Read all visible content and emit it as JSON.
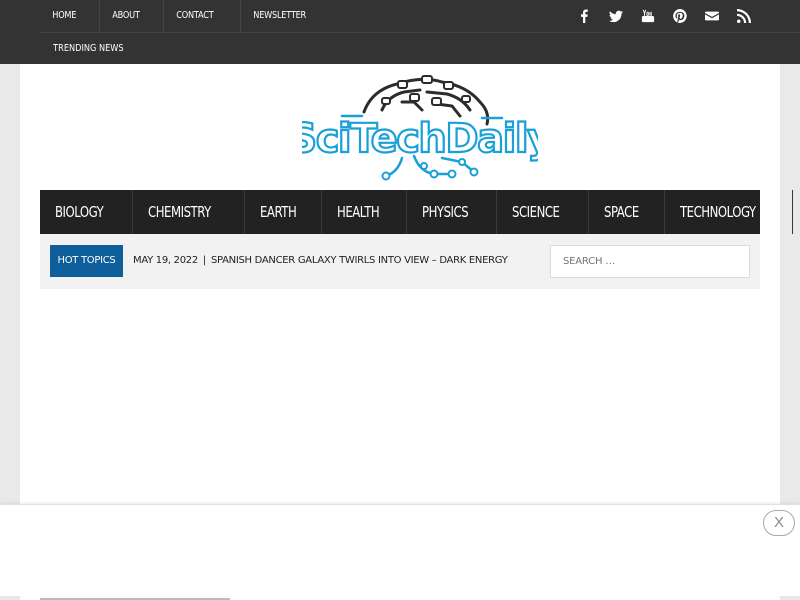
{
  "topnav": {
    "items": [
      "HOME",
      "ABOUT",
      "CONTACT",
      "NEWSLETTER"
    ],
    "trending": "TRENDING NEWS"
  },
  "social_icons": [
    "facebook-icon",
    "twitter-icon",
    "youtube-icon",
    "pinterest-icon",
    "envelope-icon",
    "rss-icon"
  ],
  "logo": {
    "text": "SciTechDaily"
  },
  "mainnav": {
    "items": [
      "BIOLOGY",
      "CHEMISTRY",
      "EARTH",
      "HEALTH",
      "PHYSICS",
      "SCIENCE",
      "SPACE",
      "TECHNOLOGY"
    ]
  },
  "ticker": {
    "label": "HOT TOPICS",
    "date": "MAY 19, 2022",
    "separator": "|",
    "headline": "SPANISH DANCER GALAXY TWIRLS INTO VIEW – DARK ENERGY"
  },
  "search": {
    "placeholder": "SEARCH …"
  },
  "ad": {
    "close_label": "X"
  },
  "colors": {
    "topbar": "#333333",
    "mainnav": "#222222",
    "hot_topics": "#0d5e9b",
    "logo_blue": "#1aa0d8",
    "logo_dark": "#2c2c2c"
  }
}
